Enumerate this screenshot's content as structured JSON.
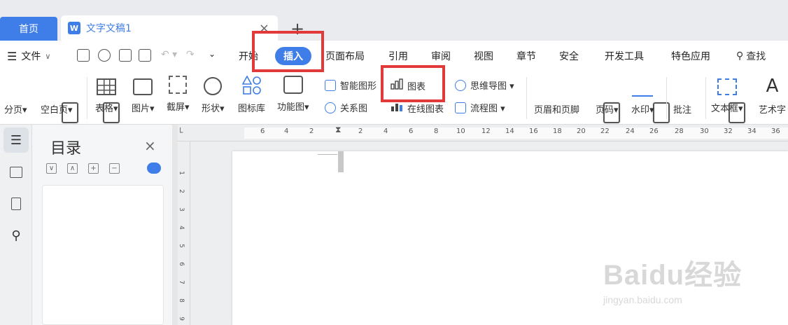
{
  "tabs": {
    "home_label": "首页",
    "doc_title": "文字文稿1",
    "doc_logo": "W",
    "close_glyph": "×",
    "add_glyph": "+"
  },
  "menu": {
    "file": "文件",
    "items": [
      "开始",
      "插入",
      "页面布局",
      "引用",
      "审阅",
      "视图",
      "章节",
      "安全",
      "开发工具",
      "特色应用"
    ],
    "active": "插入",
    "search": "查找"
  },
  "ribbon": {
    "large": [
      "分页",
      "空白页",
      "表格",
      "图片",
      "截屏",
      "形状",
      "图标库",
      "功能图"
    ],
    "smart_art": "智能图形",
    "relation": "关系图",
    "chart": "图表",
    "online_chart": "在线图表",
    "mindmap": "思维导图",
    "flowchart": "流程图",
    "right_large": [
      "页眉和页脚",
      "页码",
      "水印",
      "批注",
      "文本框",
      "艺术字"
    ]
  },
  "outline": {
    "title": "目录",
    "tools": [
      "∨",
      "∧",
      "+",
      "−"
    ]
  },
  "ruler": {
    "h_ticks": [
      "6",
      "4",
      "2",
      "2",
      "4",
      "6",
      "8",
      "10",
      "12",
      "14",
      "16",
      "18",
      "20",
      "22",
      "24",
      "26",
      "28",
      "30",
      "32",
      "34",
      "36"
    ],
    "v_ticks": [
      "1",
      "2",
      "3",
      "4",
      "5",
      "6",
      "7",
      "8",
      "9"
    ]
  },
  "watermark": {
    "brand": "Baidu经验",
    "url": "jingyan.baidu.com"
  },
  "colors": {
    "accent": "#3f7ee8",
    "highlight": "#e23a3a"
  }
}
